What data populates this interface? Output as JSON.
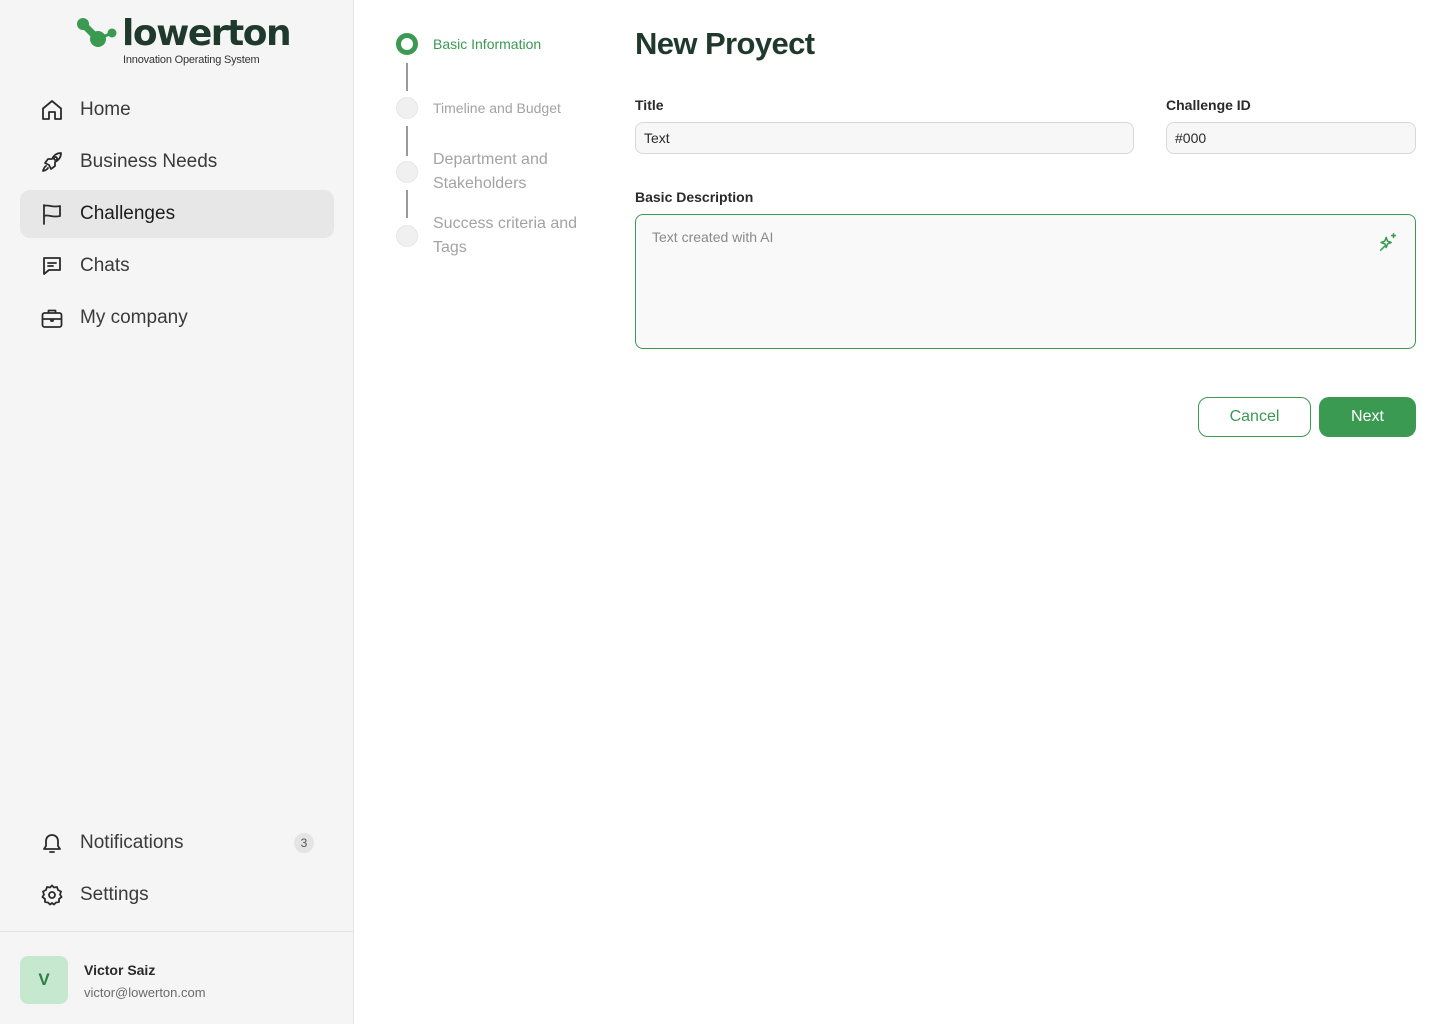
{
  "brand": {
    "name": "lowerton",
    "tagline": "Innovation Operating System",
    "accent": "#3a9a52"
  },
  "sidebar": {
    "items": [
      {
        "label": "Home",
        "icon": "home-icon"
      },
      {
        "label": "Business Needs",
        "icon": "rocket-icon"
      },
      {
        "label": "Challenges",
        "icon": "flag-icon",
        "active": true
      },
      {
        "label": "Chats",
        "icon": "chat-icon"
      },
      {
        "label": "My company",
        "icon": "briefcase-icon"
      }
    ],
    "bottom": [
      {
        "label": "Notifications",
        "icon": "bell-icon",
        "badge": "3"
      },
      {
        "label": "Settings",
        "icon": "gear-icon"
      }
    ]
  },
  "user": {
    "initial": "V",
    "name": "Victor Saiz",
    "email": "victor@lowerton.com"
  },
  "steps": [
    {
      "label": "Basic Information",
      "active": true
    },
    {
      "label": "Timeline and Budget"
    },
    {
      "label": "Department and Stakeholders"
    },
    {
      "label": "Success criteria and Tags"
    }
  ],
  "form": {
    "title": "New Proyect",
    "title_label": "Title",
    "title_value": "Text",
    "challenge_id_label": "Challenge ID",
    "challenge_id_value": "#000",
    "description_label": "Basic Description",
    "description_placeholder": "Text created with AI",
    "cancel_label": "Cancel",
    "next_label": "Next"
  }
}
